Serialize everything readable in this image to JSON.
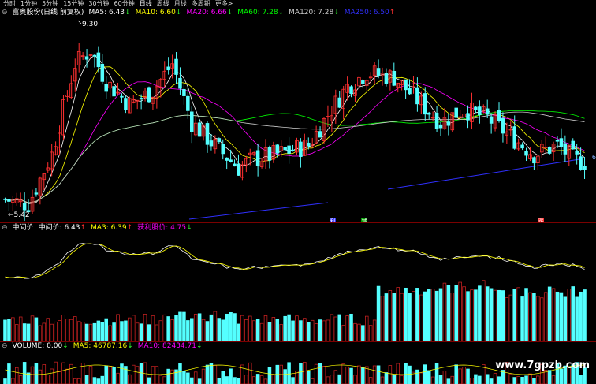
{
  "tabs": [
    "分时",
    "1分钟",
    "5分钟",
    "15分钟",
    "30分钟",
    "60分钟",
    "日线",
    "周线",
    "月线",
    "多周期",
    "更多>"
  ],
  "active_tab": "日线",
  "price_panel": {
    "title": "富奥股份(日线 前复权)",
    "ma": [
      {
        "label": "MA5: 6.43",
        "arrow": "↓",
        "color": "#ffffff"
      },
      {
        "label": "MA10: 6.60",
        "arrow": "↓",
        "color": "#ffff00"
      },
      {
        "label": "MA20: 6.66",
        "arrow": "↓",
        "color": "#ff00ff"
      },
      {
        "label": "MA60: 7.28",
        "arrow": "↓",
        "color": "#00ff00"
      },
      {
        "label": "MA120: 7.28",
        "arrow": "↓",
        "color": "#c8c8c8"
      },
      {
        "label": "MA250: 6.50",
        "arrow": "↑",
        "color": "#3030ff"
      }
    ],
    "high_label": "9.30",
    "low_label": "5.42",
    "right_label": "6"
  },
  "indicator_panel": {
    "name": "中间价",
    "values": [
      {
        "label": "中间价: 6.43",
        "arrow": "↑",
        "color": "#ffffff"
      },
      {
        "label": "MA3: 6.39",
        "arrow": "↑",
        "color": "#ffff00"
      },
      {
        "label": "获利股价: 4.75",
        "arrow": "↓",
        "color": "#ff00ff"
      }
    ]
  },
  "volume_panel": {
    "values": [
      {
        "label": "VOLUME: 0.00",
        "arrow": "↓",
        "color": "#ffffff"
      },
      {
        "label": "MA5: 46787.16",
        "arrow": "↓",
        "color": "#ffff00"
      },
      {
        "label": "MA10: 82434.71",
        "arrow": "↓",
        "color": "#ff00ff"
      }
    ]
  },
  "markers": [
    "利",
    "减",
    "涨"
  ],
  "watermark": "www.7gpzb.com",
  "colors": {
    "up": "#ff3030",
    "down": "#54ffff",
    "bg": "#000000"
  }
}
